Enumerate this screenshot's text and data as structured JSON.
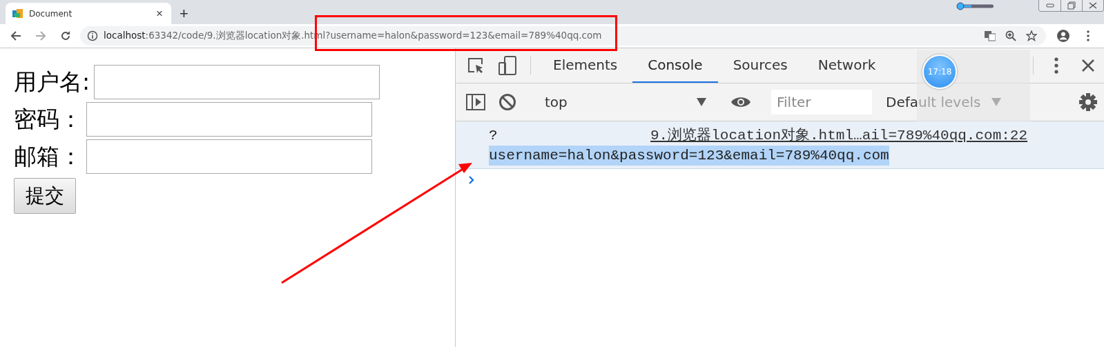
{
  "browser": {
    "tab": {
      "title": "Document",
      "close": "×"
    },
    "new_tab": "+",
    "address": {
      "host": "localhost",
      "path": ":63342/code/9.浏览器location对象.html?username=halon&password=123&email=789%40qq.com"
    }
  },
  "page": {
    "fields": [
      {
        "label": "用户名:"
      },
      {
        "label": "密码："
      },
      {
        "label": "邮箱："
      }
    ],
    "submit": "提交"
  },
  "devtools": {
    "tabs": [
      {
        "label": "Elements",
        "selected": false
      },
      {
        "label": "Console",
        "selected": true
      },
      {
        "label": "Sources",
        "selected": false
      },
      {
        "label": "Network",
        "selected": false
      }
    ],
    "context": "top",
    "filter": {
      "placeholder": "Filter"
    },
    "levels": "Default levels",
    "messages": [
      {
        "prefix": "?",
        "source": "9.浏览器location对象.html…ail=789%40qq.com:22",
        "text": "username=halon&password=123&email=789%40qq.com",
        "highlighted": true
      }
    ]
  },
  "clock": "17:18"
}
